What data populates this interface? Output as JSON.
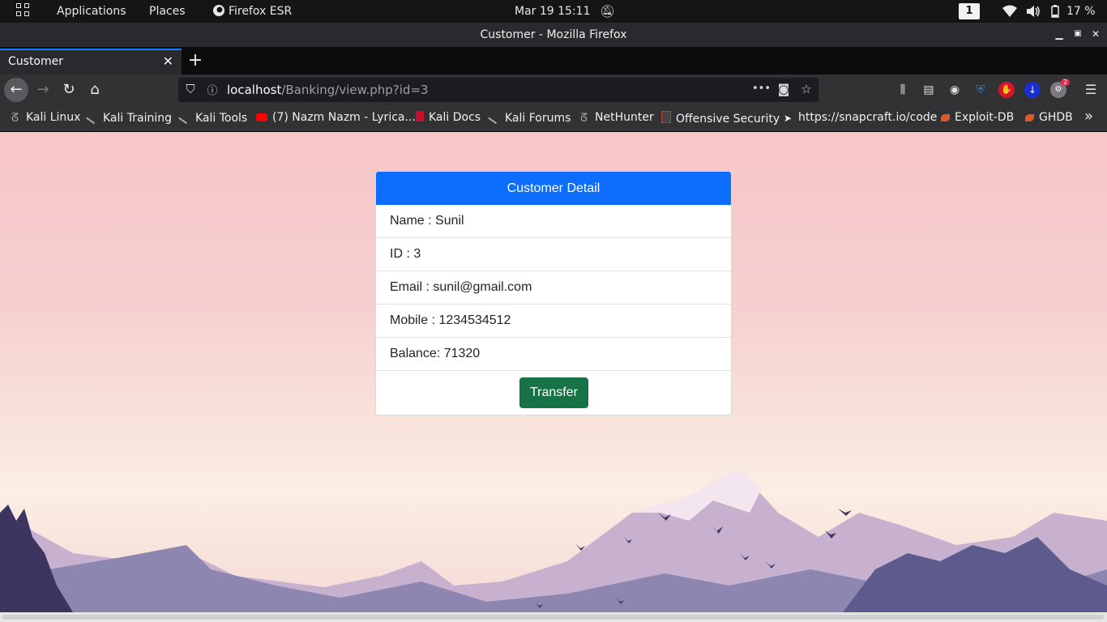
{
  "topbar": {
    "applications": "Applications",
    "places": "Places",
    "app_name": "Firefox ESR",
    "datetime": "Mar 19  15:11",
    "workspace": "1",
    "battery": "17 %"
  },
  "window": {
    "title": "Customer - Mozilla Firefox"
  },
  "tabs": [
    {
      "label": "Customer"
    }
  ],
  "urlbar": {
    "host": "localhost",
    "path": "/Banking/view.php?id=3"
  },
  "toolbar": {
    "badge_count": "2"
  },
  "bookmarks": [
    {
      "label": "Kali Linux",
      "icon": "kali-dragon-icon"
    },
    {
      "label": "Kali Training",
      "icon": "kali-dragon-icon"
    },
    {
      "label": "Kali Tools",
      "icon": "kali-dragon-icon"
    },
    {
      "label": "(7) Nazm Nazm - Lyrica...",
      "icon": "youtube-icon"
    },
    {
      "label": "Kali Docs",
      "icon": "docs-icon"
    },
    {
      "label": "Kali Forums",
      "icon": "kali-dragon-icon"
    },
    {
      "label": "NetHunter",
      "icon": "nethunter-icon"
    },
    {
      "label": "Offensive Security",
      "icon": "offsec-icon"
    },
    {
      "label": "https://snapcraft.io/code",
      "icon": "snapcraft-icon"
    },
    {
      "label": "Exploit-DB",
      "icon": "exploitdb-icon"
    },
    {
      "label": "GHDB",
      "icon": "ghdb-icon"
    }
  ],
  "customer": {
    "header": "Customer Detail",
    "name": "Name : Sunil",
    "id": "ID : 3",
    "email": "Email : sunil@gmail.com",
    "mobile": "Mobile : 1234534512",
    "balance": "Balance: 71320",
    "transfer_label": "Transfer"
  },
  "colors": {
    "card_header": "#0d6efd",
    "transfer_button": "#157347",
    "tab_accent": "#0a84ff"
  }
}
